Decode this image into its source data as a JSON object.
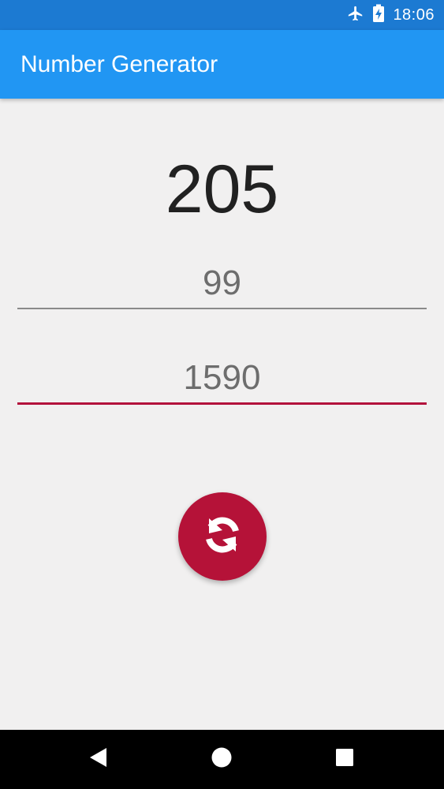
{
  "status_bar": {
    "time": "18:06",
    "icons": [
      "airplane-mode-icon",
      "battery-charging-icon"
    ],
    "color": "#1c7ad2"
  },
  "app_bar": {
    "title": "Number Generator",
    "color": "#2196f3"
  },
  "main": {
    "result": "205",
    "min_field": {
      "value": "99"
    },
    "max_field": {
      "value": "1590"
    },
    "refresh_button": {
      "icon": "refresh-icon",
      "color": "#b51238"
    },
    "accent_color": "#b3123c"
  },
  "nav_bar": {
    "buttons": [
      "back-icon",
      "home-icon",
      "recents-icon"
    ]
  }
}
